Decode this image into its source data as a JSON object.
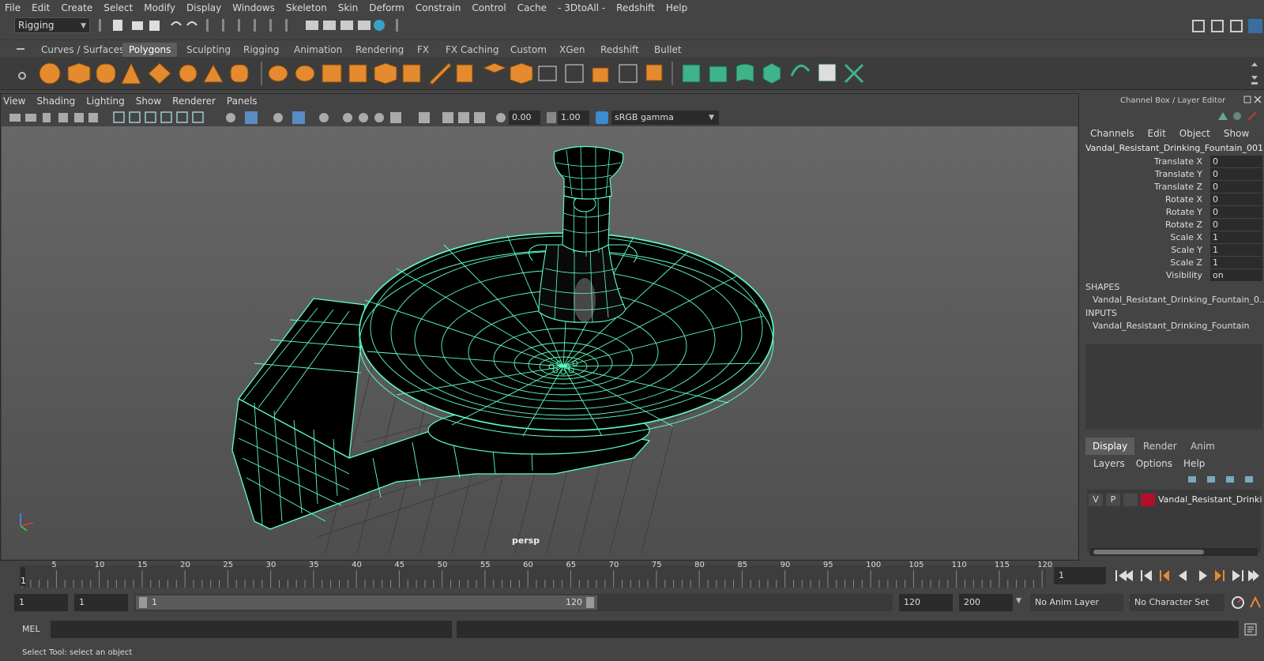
{
  "menubar": {
    "items": [
      "File",
      "Edit",
      "Create",
      "Select",
      "Modify",
      "Display",
      "Windows",
      "Skeleton",
      "Skin",
      "Deform",
      "Constrain",
      "Control",
      "Cache",
      "- 3DtoAll -",
      "Redshift",
      "Help"
    ]
  },
  "status": {
    "menuset": "Rigging"
  },
  "shelf": {
    "tabs": [
      "Curves / Surfaces",
      "Polygons",
      "Sculpting",
      "Rigging",
      "Animation",
      "Rendering",
      "FX",
      "FX Caching",
      "Custom",
      "XGen",
      "Redshift",
      "Bullet"
    ],
    "active_tab": "Polygons"
  },
  "viewport": {
    "menus": [
      "View",
      "Shading",
      "Lighting",
      "Show",
      "Renderer",
      "Panels"
    ],
    "exposure": "0.00",
    "gamma": "1.00",
    "color_space": "sRGB gamma",
    "camera_label": "persp"
  },
  "channel_box": {
    "title": "Channel Box / Layer Editor",
    "menus": [
      "Channels",
      "Edit",
      "Object",
      "Show"
    ],
    "object_name": "Vandal_Resistant_Drinking_Fountain_001",
    "attributes": [
      {
        "label": "Translate X",
        "value": "0"
      },
      {
        "label": "Translate Y",
        "value": "0"
      },
      {
        "label": "Translate Z",
        "value": "0"
      },
      {
        "label": "Rotate X",
        "value": "0"
      },
      {
        "label": "Rotate Y",
        "value": "0"
      },
      {
        "label": "Rotate Z",
        "value": "0"
      },
      {
        "label": "Scale X",
        "value": "1"
      },
      {
        "label": "Scale Y",
        "value": "1"
      },
      {
        "label": "Scale Z",
        "value": "1"
      },
      {
        "label": "Visibility",
        "value": "on"
      }
    ],
    "shapes_heading": "SHAPES",
    "shape_item": "Vandal_Resistant_Drinking_Fountain_0...",
    "inputs_heading": "INPUTS",
    "input_item": "Vandal_Resistant_Drinking_Fountain"
  },
  "layer_editor": {
    "tabs": [
      "Display",
      "Render",
      "Anim"
    ],
    "active_tab": "Display",
    "menus": [
      "Layers",
      "Options",
      "Help"
    ],
    "layer": {
      "v": "V",
      "p": "P",
      "name": "Vandal_Resistant_Drinki",
      "color": "#b0102a"
    }
  },
  "timeline": {
    "ticks": [
      "5",
      "10",
      "15",
      "20",
      "25",
      "30",
      "35",
      "40",
      "45",
      "50",
      "55",
      "60",
      "65",
      "70",
      "75",
      "80",
      "85",
      "90",
      "95",
      "100",
      "105",
      "110",
      "115",
      "120"
    ],
    "first_frame": "1",
    "current_frame": "1"
  },
  "range": {
    "start": "1",
    "playback_start": "1",
    "slider_start": "1",
    "slider_end": "120",
    "playback_end": "120",
    "end": "200",
    "anim_layer": "No Anim Layer",
    "character_set": "No Character Set"
  },
  "command_line": {
    "label": "MEL"
  },
  "help_line": {
    "text": "Select Tool: select an object"
  },
  "colors": {
    "wire": "#5dffc0",
    "accent_orange": "#e58a2f",
    "accent_green": "#3fb38a",
    "layer_red": "#b0102a"
  }
}
